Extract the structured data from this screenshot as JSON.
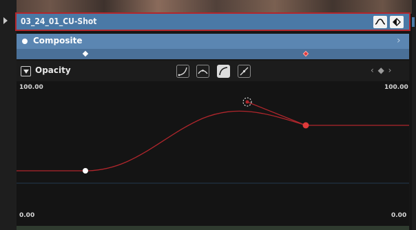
{
  "clip": {
    "title": "03_24_01_CU-Shot"
  },
  "composite": {
    "label": "Composite"
  },
  "opacity": {
    "label": "Opacity",
    "nav_glyphs": "‹ ◆ ›"
  },
  "graph": {
    "y_max_left": "100.00",
    "y_max_right": "100.00",
    "y_min_left": "0.00",
    "y_min_right": "0.00",
    "curve_color": "#b0262c",
    "keyframe_selected_color": "#e03a3a"
  },
  "icons": {
    "clip_curve": "curve-icon",
    "clip_keyframe": "keyframe-diamond-icon",
    "interp_ease_in": "ease-in-icon",
    "interp_ease_peak": "ease-peak-icon",
    "interp_ease_out": "ease-out-icon",
    "interp_linear": "linear-icon"
  }
}
